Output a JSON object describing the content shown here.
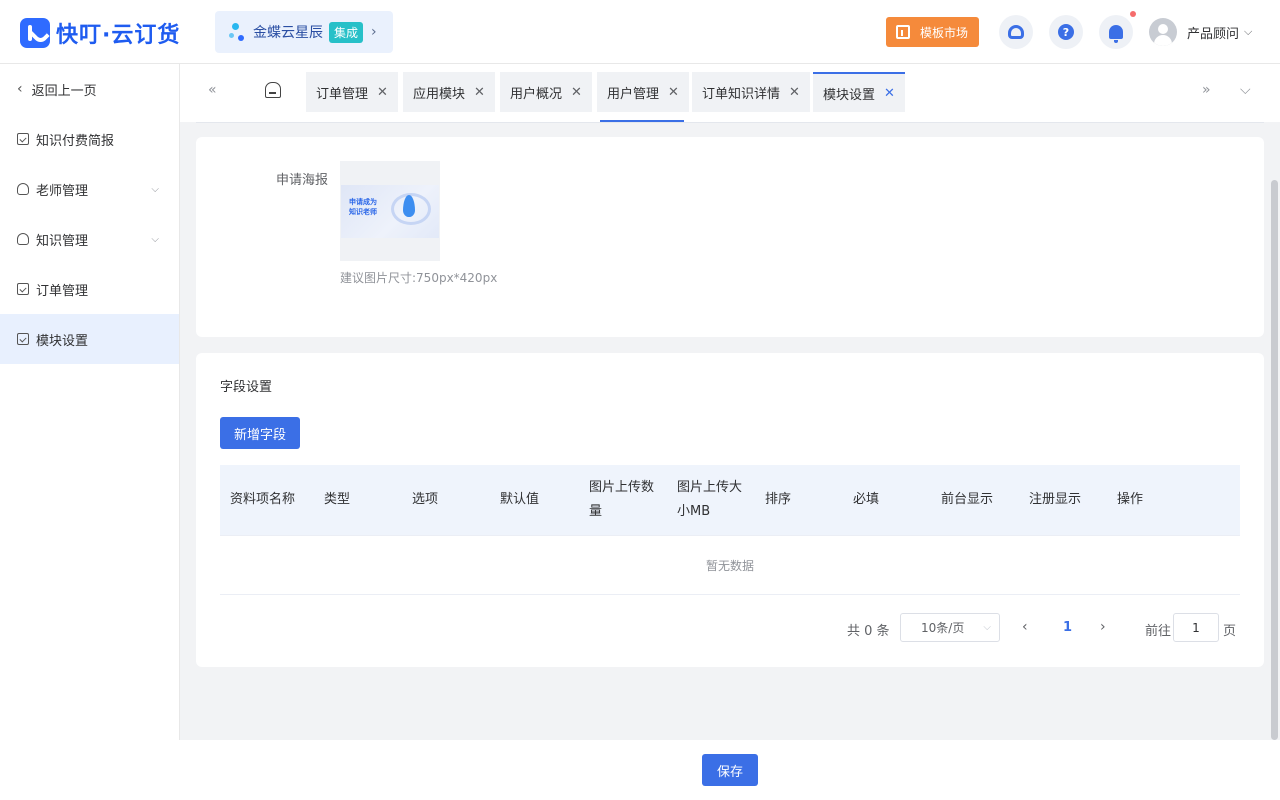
{
  "header": {
    "logo_text": "快叮·云订货",
    "app_switch": {
      "name": "金蝶云星辰",
      "badge": "集成"
    },
    "template_market": "模板市场",
    "user_name": "产品顾问"
  },
  "sidebar": {
    "back": "返回上一页",
    "items": [
      {
        "label": "知识付费简报"
      },
      {
        "label": "老师管理"
      },
      {
        "label": "知识管理"
      },
      {
        "label": "订单管理"
      },
      {
        "label": "模块设置"
      }
    ]
  },
  "tabs": [
    {
      "label": "订单管理"
    },
    {
      "label": "应用模块"
    },
    {
      "label": "用户概况"
    },
    {
      "label": "用户管理"
    },
    {
      "label": "订单知识详情"
    },
    {
      "label": "模块设置"
    }
  ],
  "poster": {
    "label": "申请海报",
    "image_line1": "申请成为",
    "image_line2": "知识老师",
    "hint": "建议图片尺寸:750px*420px"
  },
  "fields": {
    "title": "字段设置",
    "add_button": "新增字段",
    "columns": [
      "资料项名称",
      "类型",
      "选项",
      "默认值",
      "图片上传数量",
      "图片上传大小MB",
      "排序",
      "必填",
      "前台显示",
      "注册显示",
      "操作"
    ],
    "empty_text": "暂无数据"
  },
  "pagination": {
    "total": "共 0 条",
    "page_size": "10条/页",
    "current": "1",
    "goto_label": "前往",
    "goto_value": "1",
    "page_suffix": "页"
  },
  "footer": {
    "save": "保存"
  },
  "colors": {
    "primary": "#3b6fe6",
    "market": "#f58a3b",
    "badge": "#27c0c8"
  }
}
